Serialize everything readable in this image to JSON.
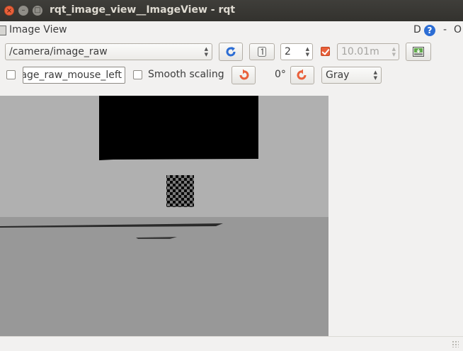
{
  "window": {
    "title": "rqt_image_view__ImageView - rqt",
    "close_glyph": "×",
    "min_glyph": "–",
    "max_glyph": "□"
  },
  "plugin_header": {
    "title": "Image View",
    "d_label": "D",
    "help_label": "?",
    "close_label": "-",
    "extra_label": "O"
  },
  "toolbar": {
    "topic_value": "/camera/image_raw",
    "spin_value": "2",
    "rate_checked": true,
    "rate_value": "10.01m",
    "mouse_checkbox_checked": false,
    "mouse_topic_value": "age_raw_mouse_left",
    "smooth_checked": false,
    "smooth_label": "Smooth scaling",
    "rotation_value": "0°",
    "color_scheme_value": "Gray"
  },
  "colors": {
    "accent_orange": "#e9603b",
    "refresh_blue": "#2c6dd4",
    "titlebar_bg": "#3c3b37"
  },
  "icons": {
    "refresh": "refresh-icon",
    "reset_zoom": "zoom-original-icon",
    "save": "save-image-icon",
    "rotate_left": "rotate-left-icon",
    "rotate_right": "rotate-right-icon"
  }
}
